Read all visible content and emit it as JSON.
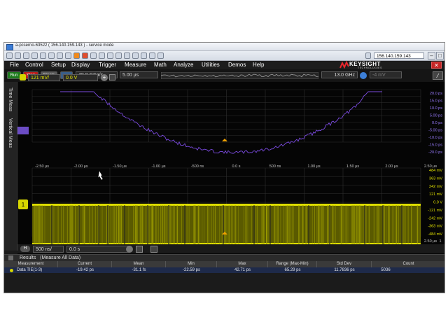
{
  "window": {
    "title": "a-pcserno-63522 ( 156.140.159.143 ) - service mode",
    "address": "156.140.159.143"
  },
  "menu": [
    "File",
    "Control",
    "Setup",
    "Display",
    "Trigger",
    "Measure",
    "Math",
    "Analyze",
    "Utilities",
    "Demos",
    "Help"
  ],
  "brand": {
    "name": "KEYSIGHT",
    "sub": "TECHNOLOGIES"
  },
  "controls": {
    "run": "Run",
    "stop": "Stop",
    "single": "Single",
    "sample_rate": "40.0 GSa/s",
    "timebase_field": "5.00 µs",
    "bandwidth": "13.0 GHz",
    "trigger_level": "-4 mV",
    "ch_scale": "121 mV/",
    "ch_offset": "0.0 V"
  },
  "sidebar": {
    "tab1": "Time Meas",
    "tab2": "Vertical Meas"
  },
  "upper_plot": {
    "x_ticks": [
      "-2.50 µs",
      "-2.00 µs",
      "-1.50 µs",
      "-1.00 µs",
      "-500 ns",
      "0.0 s",
      "500 ns",
      "1.00 µs",
      "1.50 µs",
      "2.00 µs",
      "2.50 µs"
    ],
    "y_ticks": [
      "20.0 ps",
      "15.0 ps",
      "10.0 ps",
      "5.00 ps",
      "0.0 ps",
      "-5.00 ps",
      "-10.0 ps",
      "-15.0 ps",
      "-20.0 ps"
    ],
    "trace_color": "#7b4be0"
  },
  "lower_plot": {
    "x_ticks": [
      "-2.50 µs",
      "-2.00 µs",
      "-1.50 µs",
      "-1.00 µs",
      "-500 ns",
      "0.0 s",
      "500 ns",
      "1.00 µs",
      "1.50 µs",
      "2.00 µs",
      "2.50 µs",
      "1"
    ],
    "y_ticks": [
      "484 mV",
      "363 mV",
      "242 mV",
      "121 mV",
      "0.0 V",
      "-121 mV",
      "-242 mV",
      "-363 mV",
      "-484 mV"
    ],
    "trace_color": "#d6d600",
    "channel_marker": "1"
  },
  "timebase": {
    "scale": "500 ns/",
    "position": "0.0 s"
  },
  "results": {
    "header": "Results   (Measure All Data)",
    "columns": [
      "Measurement",
      "Current",
      "Mean",
      "Min",
      "Max",
      "Range (Max-Min)",
      "Std Dev",
      "Count"
    ],
    "row": {
      "name": "Data TIE(1-3)",
      "current": "-19.42 ps",
      "mean": "-31.1 fs",
      "min": "-22.59 ps",
      "max": "42.71 ps",
      "range": "65.29 ps",
      "std_dev": "11.7836 ps",
      "count": "5036"
    }
  },
  "colors": {
    "accent_red": "#c62626",
    "waveform_yellow": "#d6d600",
    "tie_purple": "#7b4be0",
    "trigger_orange": "#f0a000"
  }
}
